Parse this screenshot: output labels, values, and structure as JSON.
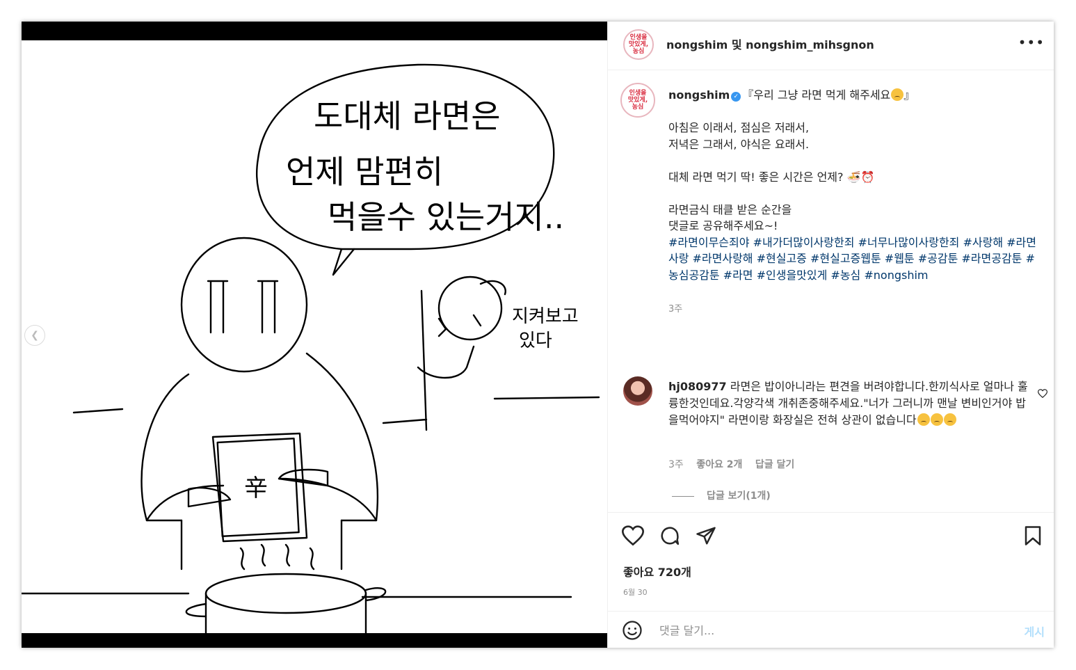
{
  "header": {
    "title": "nongshim 및 nongshim_mihsgnon",
    "logo_text": "인생을\n맛있게,\n농심",
    "more_icon": "more-icon"
  },
  "media": {
    "speech": [
      "도대체 라면은",
      "언제 맘편히",
      "먹을수 있는거지.."
    ],
    "side_text": [
      "지켜보고",
      "있다"
    ],
    "packet_text": "辛",
    "prev_icon": "chevron-left-icon"
  },
  "caption": {
    "username": "nongshim",
    "title": "『우리 그냥 라면 먹게 해주세요",
    "title_end": "』",
    "body": "아침은 이래서, 점심은 저래서,\n저녁은 그래서, 야식은 요래서.\n\n대체 라면 먹기 딱! 좋은 시간은 언제? 🍜⏰\n\n라면금식 태클 받은 순간을\n댓글로 공유해주세요~!\n",
    "hashtags": "#라면이무슨죄야 #내가더많이사랑한죄 #너무나많이사랑한죄 #사랑해 #라면사랑 #라면사랑해 #현실고증 #현실고증웹툰 #웹툰 #공감툰 #라면공감툰 #농심공감툰 #라면 #인생을맛있게 #농심 #nongshim",
    "time": "3주"
  },
  "comment": {
    "username": "hj080977",
    "text": " 라면은 밥이아니라는 편견을 버려야합니다.한끼식사로 얼마나 훌륭한것인데요.각양각색 개취존중해주세요.\"너가 그러니까 맨날 변비인거야 밥을먹어야지\" 라면이랑 화장실은 전혀 상관이 없습니다",
    "time": "3주",
    "likes": "좋아요 2개",
    "reply": "답글 달기",
    "view_replies": "답글 보기(1개)"
  },
  "actions": {
    "likes": "좋아요 720개",
    "date": "6월 30"
  },
  "composer": {
    "placeholder": "댓글 달기...",
    "post": "게시"
  }
}
